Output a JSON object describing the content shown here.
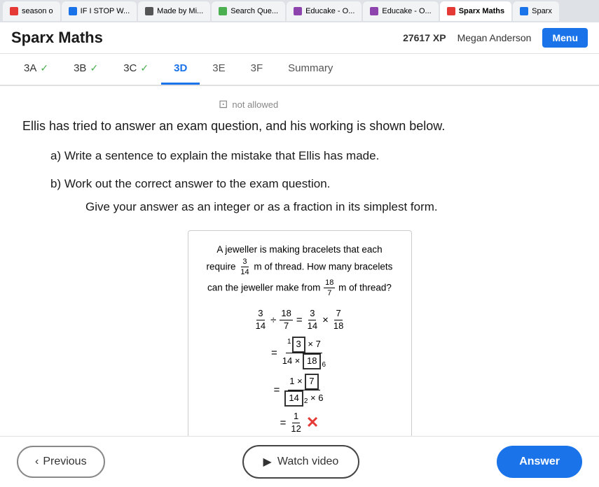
{
  "browser": {
    "tabs": [
      {
        "label": "season o",
        "icon_color": "#e53935",
        "active": false
      },
      {
        "label": "IF I STOP W...",
        "icon_color": "#1a73e8",
        "active": false
      },
      {
        "label": "Made by Mi...",
        "icon_color": "#555",
        "active": false
      },
      {
        "label": "Search Que...",
        "icon_color": "#4caf50",
        "active": false
      },
      {
        "label": "Educake - O...",
        "icon_color": "#8e44ad",
        "active": false
      },
      {
        "label": "Educake - O...",
        "icon_color": "#8e44ad",
        "active": false
      },
      {
        "label": "Sparx Maths",
        "icon_color": "#e53935",
        "active": true
      },
      {
        "label": "Sparx",
        "icon_color": "#1a73e8",
        "active": false
      }
    ]
  },
  "header": {
    "title": "Sparx Maths",
    "xp": "27617 XP",
    "user": "Megan Anderson",
    "menu_label": "Menu"
  },
  "nav": {
    "tabs": [
      {
        "id": "3A",
        "label": "3A",
        "state": "completed"
      },
      {
        "id": "3B",
        "label": "3B",
        "state": "completed"
      },
      {
        "id": "3C",
        "label": "3C",
        "state": "completed"
      },
      {
        "id": "3D",
        "label": "3D",
        "state": "active"
      },
      {
        "id": "3E",
        "label": "3E",
        "state": "normal"
      },
      {
        "id": "3F",
        "label": "3F",
        "state": "normal"
      },
      {
        "id": "Summary",
        "label": "Summary",
        "state": "normal"
      }
    ]
  },
  "content": {
    "not_allowed_label": "not allowed",
    "question_intro": "Ellis has tried to answer an exam question, and his working is shown below.",
    "part_a": "a) Write a sentence to explain the mistake that Ellis has made.",
    "part_b_line1": "b) Work out the correct answer to the exam question.",
    "part_b_line2": "Give your answer as an integer or as a fraction in its simplest form.",
    "working": {
      "problem": "A jeweller is making bracelets that each require",
      "fraction_require_num": "3",
      "fraction_require_den": "14",
      "problem_mid": "m of thread. How many bracelets can the jeweller make from",
      "fraction_from_num": "18",
      "fraction_from_den": "7",
      "problem_end": "m of thread?",
      "step1_lhs_num": "3",
      "step1_lhs_den": "14",
      "step1_op": "÷",
      "step1_rhs_num": "18",
      "step1_rhs_den": "7",
      "step1_eq": "=",
      "step1_rhs2_num": "3",
      "step1_rhs2_den": "14",
      "step1_x": "×",
      "step1_rhs3_num": "7",
      "step1_rhs3_den": "18",
      "step2_eq": "=",
      "step2_num": "3",
      "step2_x": "×",
      "step2_rhs_num": "7",
      "step2_lden": "14",
      "step2_x2": "×",
      "step2_rden_boxed": "18",
      "step3_eq": "=",
      "step3_num": "1",
      "step3_x": "×",
      "step3_rhs_boxed": "7",
      "step3_lden_boxed": "14",
      "step3_x2": "×",
      "step3_rden": "6",
      "step4_eq": "=",
      "step4_num": "1",
      "step4_den": "12",
      "cross": "✕"
    }
  },
  "footer": {
    "prev_label": "Previous",
    "watch_label": "Watch video",
    "answer_label": "Answer"
  }
}
